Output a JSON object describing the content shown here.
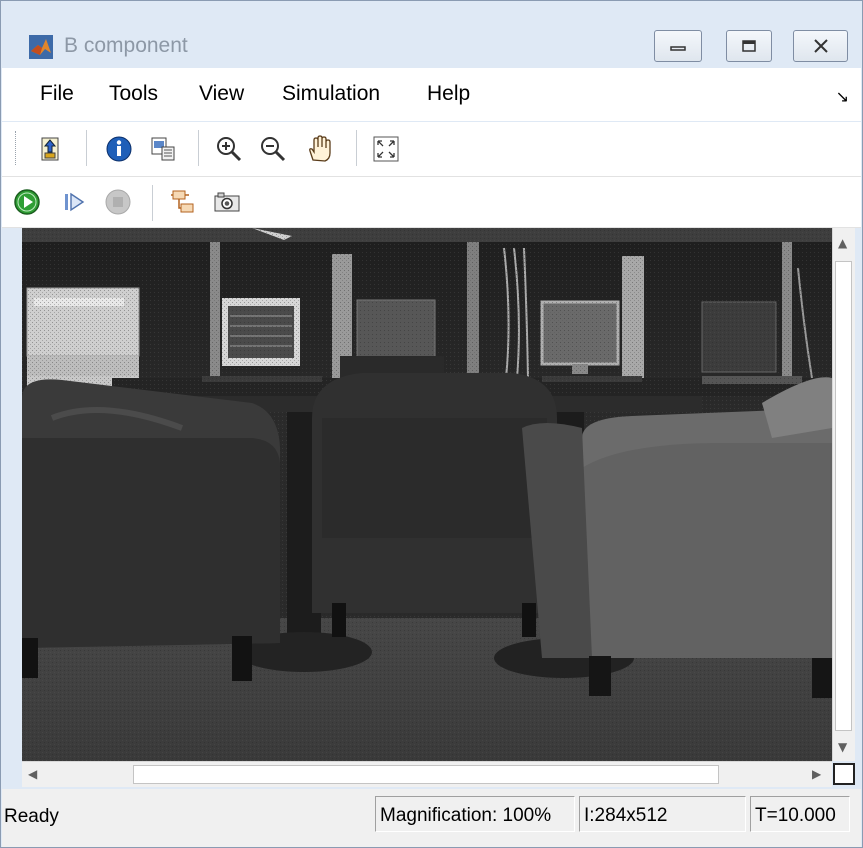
{
  "window": {
    "title": "B component",
    "controls": {
      "minimize": "minimize-icon",
      "maximize": "maximize-icon",
      "close": "close-icon"
    }
  },
  "menubar": {
    "items": [
      "File",
      "Tools",
      "View",
      "Simulation",
      "Help"
    ],
    "overflow_icon": "dock-arrow-icon"
  },
  "toolbar1": {
    "tools": [
      "parent-model-icon",
      "info-icon",
      "export-icon",
      "zoom-in-icon",
      "zoom-out-icon",
      "pan-hand-icon",
      "fit-to-window-icon"
    ]
  },
  "toolbar2": {
    "tools": [
      "run-icon",
      "step-forward-icon",
      "stop-icon",
      "highlight-simulink-block-icon",
      "snapshot-camera-icon"
    ]
  },
  "viewer": {
    "image_description_icon": "grayscale-video-frame",
    "scroll": {
      "horizontal": "horizontal-scrollbar",
      "vertical": "vertical-scrollbar"
    }
  },
  "statusbar": {
    "state": "Ready",
    "magnification": "Magnification: 100%",
    "image_size": "I:284x512",
    "time": "T=10.000"
  },
  "colors": {
    "chrome": "#dfe9f5",
    "statusbar": "#f0f0f0",
    "run_green": "#2f9e34"
  }
}
